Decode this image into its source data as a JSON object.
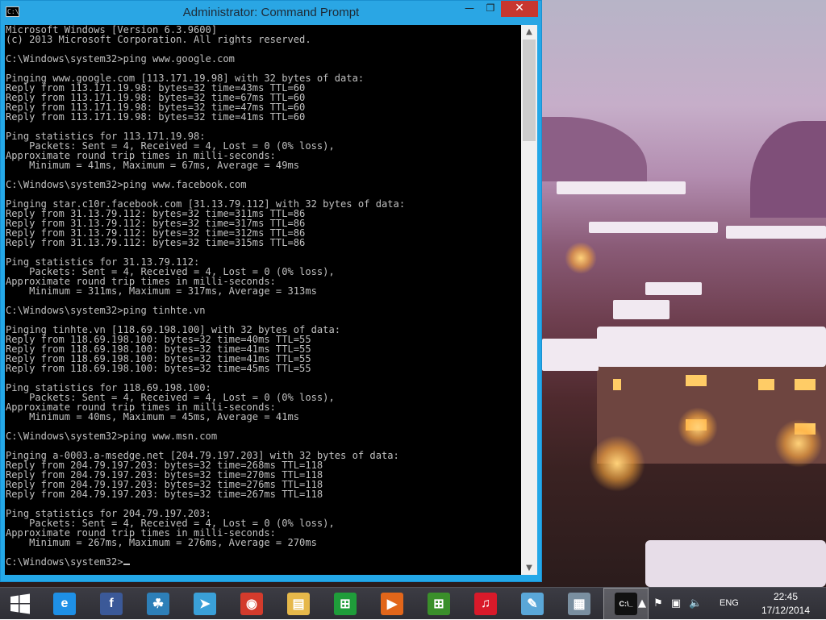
{
  "window": {
    "title": "Administrator: Command Prompt",
    "icon_text": "C:\\",
    "minimize_glyph": "—",
    "maximize_glyph": "❐",
    "close_glyph": "✕"
  },
  "console": {
    "lines": [
      "Microsoft Windows [Version 6.3.9600]",
      "(c) 2013 Microsoft Corporation. All rights reserved.",
      "",
      "C:\\Windows\\system32>ping www.google.com",
      "",
      "Pinging www.google.com [113.171.19.98] with 32 bytes of data:",
      "Reply from 113.171.19.98: bytes=32 time=43ms TTL=60",
      "Reply from 113.171.19.98: bytes=32 time=67ms TTL=60",
      "Reply from 113.171.19.98: bytes=32 time=47ms TTL=60",
      "Reply from 113.171.19.98: bytes=32 time=41ms TTL=60",
      "",
      "Ping statistics for 113.171.19.98:",
      "    Packets: Sent = 4, Received = 4, Lost = 0 (0% loss),",
      "Approximate round trip times in milli-seconds:",
      "    Minimum = 41ms, Maximum = 67ms, Average = 49ms",
      "",
      "C:\\Windows\\system32>ping www.facebook.com",
      "",
      "Pinging star.c10r.facebook.com [31.13.79.112] with 32 bytes of data:",
      "Reply from 31.13.79.112: bytes=32 time=311ms TTL=86",
      "Reply from 31.13.79.112: bytes=32 time=317ms TTL=86",
      "Reply from 31.13.79.112: bytes=32 time=312ms TTL=86",
      "Reply from 31.13.79.112: bytes=32 time=315ms TTL=86",
      "",
      "Ping statistics for 31.13.79.112:",
      "    Packets: Sent = 4, Received = 4, Lost = 0 (0% loss),",
      "Approximate round trip times in milli-seconds:",
      "    Minimum = 311ms, Maximum = 317ms, Average = 313ms",
      "",
      "C:\\Windows\\system32>ping tinhte.vn",
      "",
      "Pinging tinhte.vn [118.69.198.100] with 32 bytes of data:",
      "Reply from 118.69.198.100: bytes=32 time=40ms TTL=55",
      "Reply from 118.69.198.100: bytes=32 time=41ms TTL=55",
      "Reply from 118.69.198.100: bytes=32 time=41ms TTL=55",
      "Reply from 118.69.198.100: bytes=32 time=45ms TTL=55",
      "",
      "Ping statistics for 118.69.198.100:",
      "    Packets: Sent = 4, Received = 4, Lost = 0 (0% loss),",
      "Approximate round trip times in milli-seconds:",
      "    Minimum = 40ms, Maximum = 45ms, Average = 41ms",
      "",
      "C:\\Windows\\system32>ping www.msn.com",
      "",
      "Pinging a-0003.a-msedge.net [204.79.197.203] with 32 bytes of data:",
      "Reply from 204.79.197.203: bytes=32 time=268ms TTL=118",
      "Reply from 204.79.197.203: bytes=32 time=270ms TTL=118",
      "Reply from 204.79.197.203: bytes=32 time=276ms TTL=118",
      "Reply from 204.79.197.203: bytes=32 time=267ms TTL=118",
      "",
      "Ping statistics for 204.79.197.203:",
      "    Packets: Sent = 4, Received = 4, Lost = 0 (0% loss),",
      "Approximate round trip times in milli-seconds:",
      "    Minimum = 267ms, Maximum = 276ms, Average = 270ms",
      "",
      "C:\\Windows\\system32>"
    ]
  },
  "scrollbar": {
    "up_glyph": "▲",
    "down_glyph": "▼"
  },
  "taskbar": {
    "start_icon": "windows-start-icon",
    "pinned": [
      {
        "name": "internet-explorer",
        "glyph": "e",
        "color": "#1e90e6"
      },
      {
        "name": "facebook",
        "glyph": "f",
        "color": "#3b5998"
      },
      {
        "name": "people",
        "glyph": "☘",
        "color": "#2d7fb8"
      },
      {
        "name": "send",
        "glyph": "➤",
        "color": "#3aa0d8"
      },
      {
        "name": "chrome",
        "glyph": "◉",
        "color": "#d33b2c"
      },
      {
        "name": "file-explorer",
        "glyph": "▤",
        "color": "#e6b84a"
      },
      {
        "name": "store",
        "glyph": "⊞",
        "color": "#1f9d3a"
      },
      {
        "name": "media",
        "glyph": "▶",
        "color": "#e2661a"
      },
      {
        "name": "windows-xp",
        "glyph": "⊞",
        "color": "#3a8f2a"
      },
      {
        "name": "itunes",
        "glyph": "♫",
        "color": "#d91a2a"
      },
      {
        "name": "notes",
        "glyph": "✎",
        "color": "#5aa7d8"
      },
      {
        "name": "resource-monitor",
        "glyph": "▦",
        "color": "#7a8fa0"
      },
      {
        "name": "command-prompt",
        "glyph": "C:\\_",
        "color": "#111111"
      }
    ],
    "tray": {
      "language": "ENG",
      "time": "22:45",
      "date": "17/12/2014"
    }
  },
  "colors": {
    "titlebar": "#2aa6e4",
    "console_bg": "#000000",
    "console_fg": "#c0c0c0",
    "close": "#c7372f"
  }
}
